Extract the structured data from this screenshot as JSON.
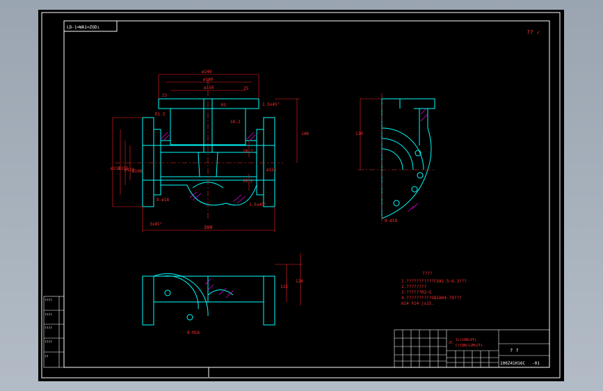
{
  "drawing": {
    "title_box": "LD-1≈WA1≈ZODı",
    "roughness_mark": "?? ✓",
    "dims": {
      "d240": "ø240",
      "d180": "ø180",
      "d150": "ø150",
      "d215": "ø215",
      "d155": "ø155",
      "d120": "ø120",
      "d100": "ø100",
      "d125": "ø125",
      "len300": "300",
      "h148": "148",
      "h130": "130",
      "h115": "115",
      "h124": "124",
      "v102a": "10.2",
      "v102b": "10.2",
      "v102c": "10.2",
      "chamfer1": "1.5x45°",
      "chamfer2": "1.5x45°",
      "chamfer3": "3x45°",
      "holes1": "8-ø18",
      "holes2": "8-M16",
      "r5": "R5",
      "r15": "R1.5",
      "s23": "23",
      "s25": "25"
    },
    "notes": {
      "heading": "????",
      "lines": [
        "1.???????????CVA1.5~6.3???",
        "2.????????",
        "3.??????R2~5",
        "4.??????????GB1804-79???",
        "  m14 h14 js15."
      ]
    },
    "title_block": {
      "mat1": "1Cr18Ni9Ti",
      "mat2": "Cr18Ni12Mo2Ti",
      "code_prefix": "2C",
      "name": "?   ?",
      "number": "100Z41H16C",
      "suffix": "-01"
    },
    "left_table": [
      "????",
      "????",
      "????",
      "????",
      "??"
    ]
  },
  "colors": {
    "background": "#000000",
    "frame": "#ffffff",
    "outline": "#00ffff",
    "dimension": "#ff2020",
    "center": "#ff3030",
    "hatch": "#ff00ff",
    "text": "#ffffff"
  }
}
